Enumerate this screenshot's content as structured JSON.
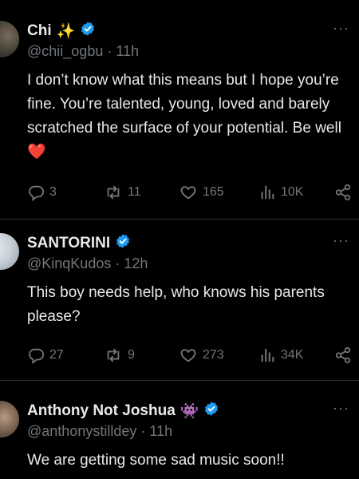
{
  "tweets": [
    {
      "name": "Chi",
      "name_emoji": "✨",
      "handle": "@chii_ogbu",
      "time": "11h",
      "body": "I don’t know what this means but I hope you’re fine. You’re talented, young, loved and barely scratched the surface of your potential. Be well",
      "body_emoji": "❤️",
      "replies": "3",
      "retweets": "11",
      "likes": "165",
      "views": "10K"
    },
    {
      "name": "SANTORINI",
      "handle": "@KinqKudos",
      "time": "12h",
      "body": "This boy needs help, who knows his parents please?",
      "replies": "27",
      "retweets": "9",
      "likes": "273",
      "views": "34K"
    },
    {
      "name": "Anthony Not Joshua",
      "name_emoji": "👾",
      "handle": "@anthonystilldey",
      "time": "11h",
      "body": "We are getting some sad music soon!!"
    }
  ],
  "ui": {
    "separator": "·",
    "more_glyph": "···"
  },
  "colors": {
    "background": "#000000",
    "text": "#e7e9ea",
    "muted": "#71767b",
    "verified": "#1d9bf0",
    "divider": "#2f3336",
    "heart": "#f91880"
  }
}
